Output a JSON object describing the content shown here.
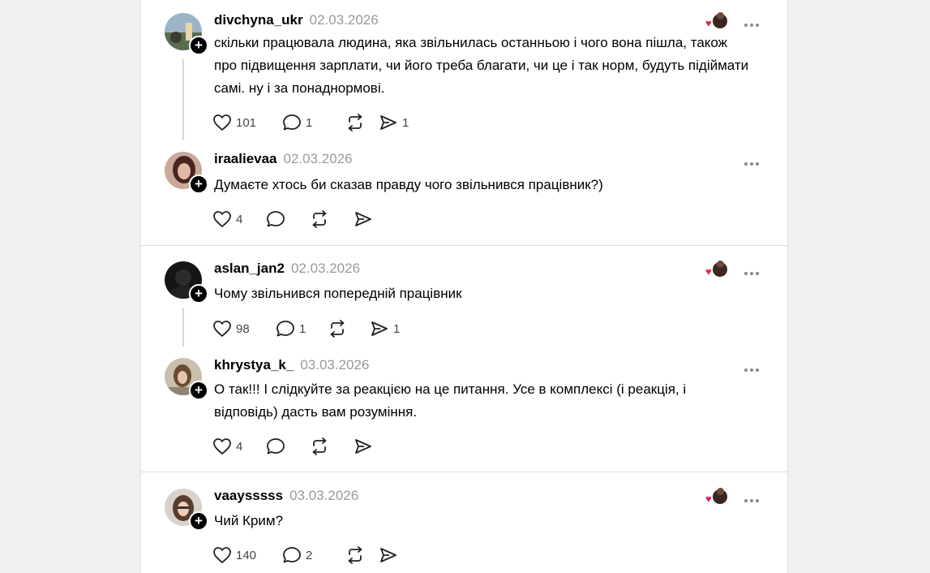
{
  "posts": [
    {
      "user": "divchyna_ukr",
      "date": "02.03.2026",
      "text": "скільки працювала людина, яка звільнилась останньою і чого вона пішла, також про підвищення зарплати, чи його треба благати, чи це і так норм, будуть підіймати самі. ну і за понаднормові.",
      "likes": "101",
      "replies": "1",
      "reposts": "",
      "shares": "1"
    },
    {
      "user": "iraalievaa",
      "date": "02.03.2026",
      "text": "Думаєте хтось би сказав правду чого звільнився працівник?)",
      "likes": "4",
      "replies": "",
      "reposts": "",
      "shares": ""
    },
    {
      "user": "aslan_jan2",
      "date": "02.03.2026",
      "text": "Чому звільнився попередній працівник",
      "likes": "98",
      "replies": "1",
      "reposts": "",
      "shares": "1"
    },
    {
      "user": "khrystya_k_",
      "date": "03.03.2026",
      "text": "О так!!! І слідкуйте за реакцією на це питання. Усе в комплексі (і реакція, і відповідь) дасть вам розуміння.",
      "likes": "4",
      "replies": "",
      "reposts": "",
      "shares": ""
    },
    {
      "user": "vaaysssss",
      "date": "03.03.2026",
      "text": "Чий Крим?",
      "likes": "140",
      "replies": "2",
      "reposts": "",
      "shares": ""
    }
  ],
  "icons": {
    "like": "heart-icon",
    "reply": "comment-icon",
    "repost": "repost-icon",
    "share": "send-icon",
    "more": "more-icon",
    "follow": "plus-icon"
  },
  "colors": {
    "background": "#f0f0f0",
    "card": "#ffffff",
    "date": "#999999",
    "heart_reaction": "#e0245e"
  }
}
